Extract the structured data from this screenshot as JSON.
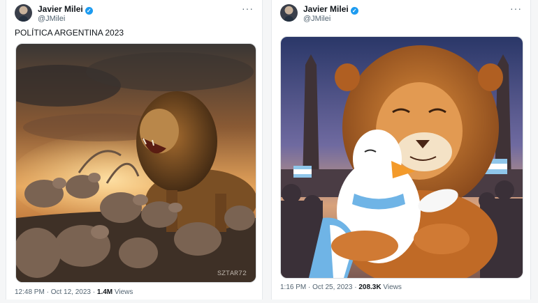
{
  "tweets": [
    {
      "author_name": "Javier Milei",
      "verified_icon": "✓",
      "handle": "@JMilei",
      "more_icon": "···",
      "text": "POLÍTICA ARGENTINA 2023",
      "image_watermark": "SZTAR72",
      "time": "12:48 PM",
      "date": "Oct 12, 2023",
      "views_count": "1.4M",
      "views_label": "Views",
      "separator": "·"
    },
    {
      "author_name": "Javier Milei",
      "verified_icon": "✓",
      "handle": "@JMilei",
      "more_icon": "···",
      "time": "1:16 PM",
      "date": "Oct 25, 2023",
      "views_count": "208.3K",
      "views_label": "Views",
      "separator": "·"
    }
  ],
  "colors": {
    "verified_badge": "#1d9bf0",
    "secondary_text": "#536471",
    "card_border": "#e6e9ec"
  }
}
